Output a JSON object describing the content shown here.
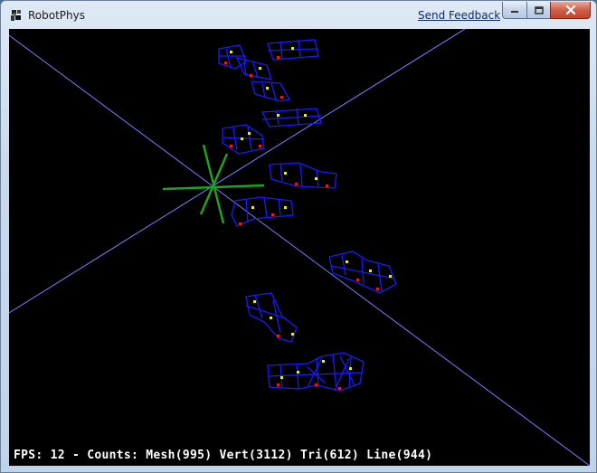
{
  "window": {
    "title": "RobotPhys",
    "feedback_link": "Send Feedback"
  },
  "caption_buttons": {
    "minimize": "minimize-icon",
    "maximize": "maximize-icon",
    "close": "close-icon"
  },
  "viewport": {
    "background": "#000000",
    "grid_line_color": "#7b7bff",
    "axis_color": "#1fa31f",
    "mesh_color": "#1a1aff",
    "joint_color_yellow": "#e6e64d",
    "joint_color_red": "#e02020",
    "status": "FPS: 12 - Counts: Mesh(995) Vert(3112) Tri(612) Line(944)"
  }
}
